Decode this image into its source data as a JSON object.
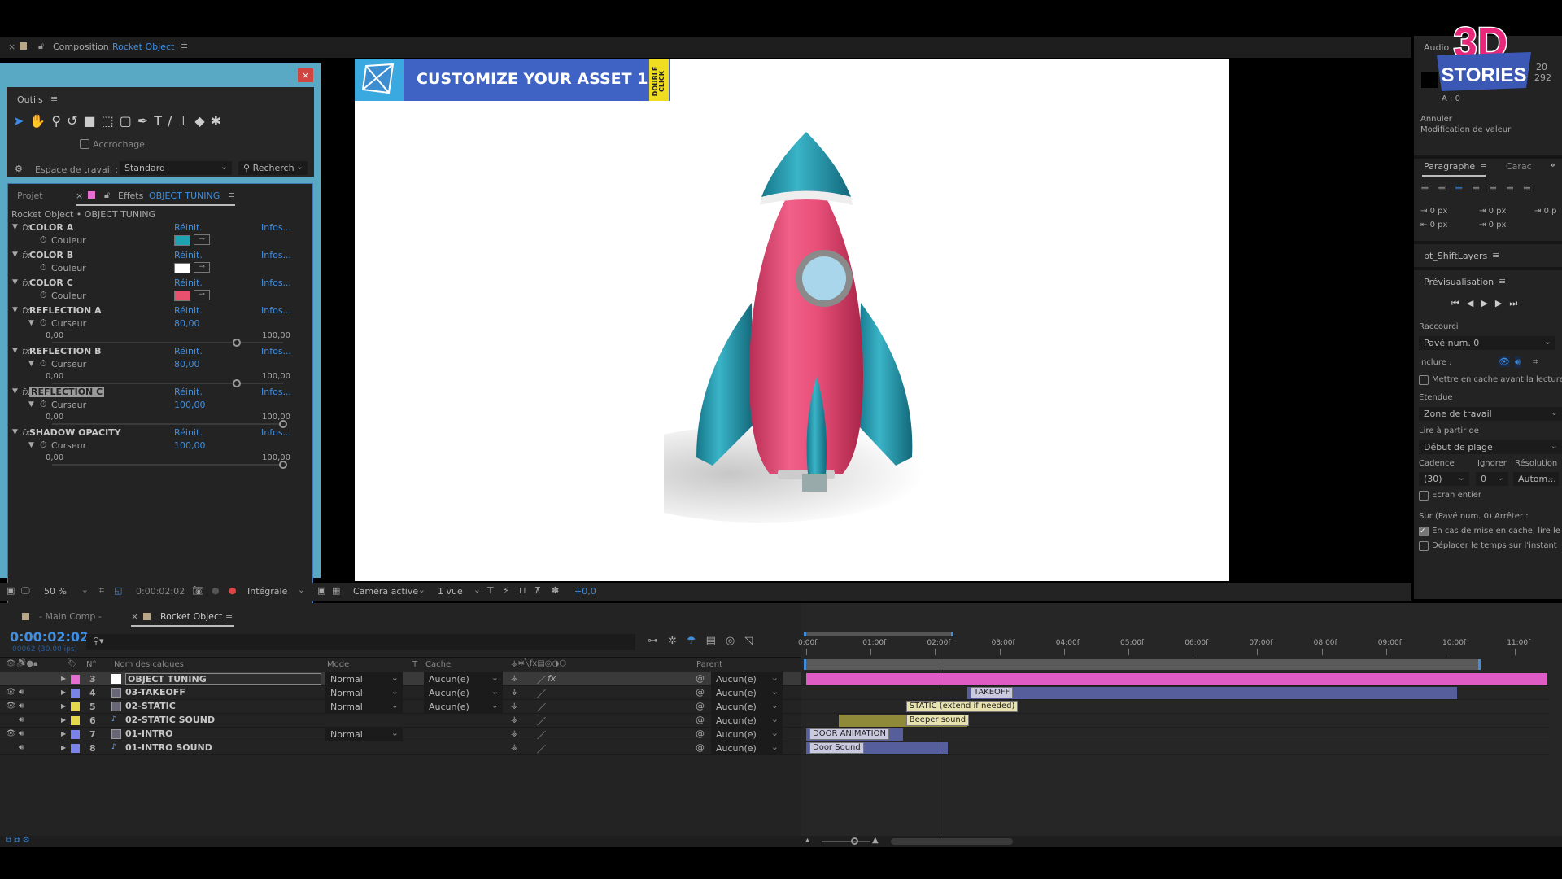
{
  "comp_header": {
    "label": "Composition",
    "name": "Rocket Object"
  },
  "effects_panel": {
    "tools_title": "Outils",
    "snapping": "Accrochage",
    "workspace_label": "Espace de travail :",
    "workspace_value": "Standard",
    "search_placeholder": "Recherch",
    "tab_project": "Projet",
    "tab_effects": "Effets",
    "tab_layer": "OBJECT TUNING",
    "breadcrumb": "Rocket Object • OBJECT TUNING",
    "reset": "Réinit.",
    "about": "Infos...",
    "effects": [
      {
        "name": "COLOR A",
        "param": "Couleur",
        "type": "color",
        "color": "#1fa3b3"
      },
      {
        "name": "COLOR B",
        "param": "Couleur",
        "type": "color",
        "color": "#ffffff"
      },
      {
        "name": "COLOR C",
        "param": "Couleur",
        "type": "color",
        "color": "#e8506e"
      },
      {
        "name": "REFLECTION A",
        "param": "Curseur",
        "type": "slider",
        "value": "80,00",
        "fraction": 0.8,
        "min": "0,00",
        "max": "100,00"
      },
      {
        "name": "REFLECTION B",
        "param": "Curseur",
        "type": "slider",
        "value": "80,00",
        "fraction": 0.8,
        "min": "0,00",
        "max": "100,00"
      },
      {
        "name": "REFLECTION C",
        "param": "Curseur",
        "type": "slider",
        "value": "100,00",
        "fraction": 1.0,
        "min": "0,00",
        "max": "100,00",
        "selected": true
      },
      {
        "name": "SHADOW OPACITY",
        "param": "Curseur",
        "type": "slider",
        "value": "100,00",
        "fraction": 1.0,
        "min": "0,00",
        "max": "100,00"
      }
    ]
  },
  "viewer": {
    "banner_title": "CUSTOMIZE YOUR ASSET 1",
    "banner_tag": "DOUBLE CLICK",
    "toolbar": {
      "zoom": "50 %",
      "timecode": "0:00:02:02",
      "resolution": "Intégrale",
      "camera": "Caméra active",
      "views": "1 vue",
      "exposure": "+0,0"
    }
  },
  "right_panel": {
    "logo_text": "3D STORIES",
    "audio": "Audio",
    "info_vals": [
      "20",
      "292"
    ],
    "alpha": "A : 0",
    "undo": "Annuler",
    "undo_detail": "Modification de valeur",
    "tab_paragraph": "Paragraphe",
    "tab_character": "Carac",
    "indent_vals": [
      "0 px",
      "0 px",
      "0 p",
      "0 px",
      "0 px"
    ],
    "shift_layers": "pt_ShiftLayers",
    "preview_title": "Prévisualisation",
    "shortcut_label": "Raccourci",
    "shortcut_value": "Pavé num. 0",
    "include_label": "Inclure :",
    "cache_before": "Mettre en cache avant la lecture",
    "range_label": "Etendue",
    "range_value": "Zone de travail",
    "play_from_label": "Lire à partir de",
    "play_from_value": "Début de plage",
    "framerate_label": "Cadence",
    "skip_label": "Ignorer",
    "resolution_label": "Résolution",
    "framerate_value": "(30)",
    "skip_value": "0",
    "resolution_value": "Autom...",
    "fullscreen": "Ecran entier",
    "stop_label": "Sur (Pavé num. 0) Arrêter :",
    "opt1": "En cas de mise en cache, lire le",
    "opt1_checked": true,
    "opt2": "Déplacer le temps sur l'instant",
    "opt2_checked": false
  },
  "timeline": {
    "tab_main": "- Main Comp -",
    "tab_active": "Rocket Object",
    "timecode": "0:00:02:02",
    "frame_info": "00062 (30.00 ips)",
    "columns": {
      "number": "N°",
      "name": "Nom des calques",
      "mode": "Mode",
      "t": "T",
      "matte": "Cache",
      "parent": "Parent"
    },
    "ruler": [
      "0:00f",
      "01:00f",
      "02:00f",
      "03:00f",
      "04:00f",
      "05:00f",
      "06:00f",
      "07:00f",
      "08:00f",
      "09:00f",
      "10:00f",
      "11:00f"
    ],
    "current_time_s": 2.07,
    "work_area_s": [
      0,
      10.5
    ],
    "layers": [
      {
        "num": "3",
        "name": "OBJECT TUNING",
        "label_color": "#e66ed1",
        "icon": "solid",
        "mode": "Normal",
        "matte": "Aucun(e)",
        "parent": "Aucun(e)",
        "video": false,
        "fx": true,
        "start": 0,
        "end": 11.5,
        "bar_color": "#de5cc4",
        "marker": ""
      },
      {
        "num": "4",
        "name": "03-TAKEOFF",
        "label_color": "#7a83e6",
        "icon": "comp",
        "mode": "Normal",
        "matte": "Aucun(e)",
        "parent": "Aucun(e)",
        "video": true,
        "start": 2.5,
        "end": 10.1,
        "bar_color": "#565f9c",
        "marker": "TAKEOFF"
      },
      {
        "num": "5",
        "name": "02-STATIC",
        "label_color": "#e6d84d",
        "icon": "comp",
        "mode": "Normal",
        "matte": "Aucun(e)",
        "parent": "Aucun(e)",
        "video": true,
        "start": 1.5,
        "end": 1.5,
        "bar_color": "#8f8a3a",
        "marker": "STATIC (extend if needed)"
      },
      {
        "num": "6",
        "name": "02-STATIC SOUND",
        "label_color": "#e6d84d",
        "icon": "audio",
        "mode": "",
        "matte": "",
        "parent": "Aucun(e)",
        "video": false,
        "start": 0.5,
        "end": 2.5,
        "bar_color": "#8f8a3a",
        "marker": "Beeper sound"
      },
      {
        "num": "7",
        "name": "01-INTRO",
        "label_color": "#7a83e6",
        "icon": "comp",
        "mode": "Normal",
        "matte": "",
        "parent": "Aucun(e)",
        "video": true,
        "start": 0,
        "end": 1.5,
        "bar_color": "#565f9c",
        "marker": "DOOR ANIMATION"
      },
      {
        "num": "8",
        "name": "01-INTRO SOUND",
        "label_color": "#7a83e6",
        "icon": "audio",
        "mode": "",
        "matte": "",
        "parent": "Aucun(e)",
        "video": false,
        "start": 0,
        "end": 2.2,
        "bar_color": "#565f9c",
        "marker": "Door Sound"
      }
    ]
  }
}
